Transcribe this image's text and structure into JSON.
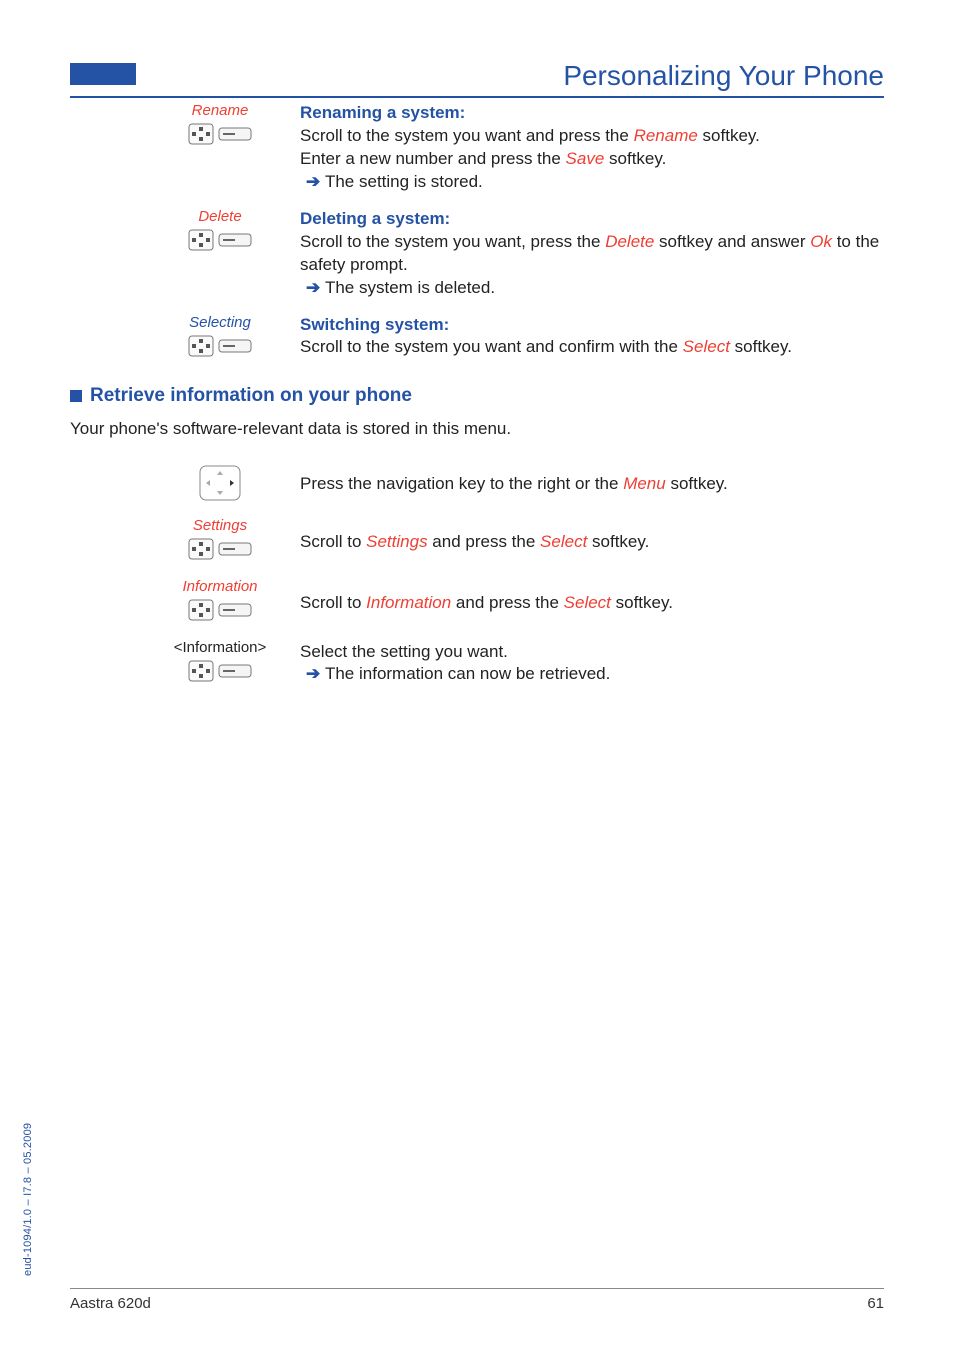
{
  "header": {
    "title": "Personalizing Your Phone"
  },
  "block1": {
    "entries": [
      {
        "lead": {
          "text": "Rename",
          "cls": "red"
        },
        "heading": "Renaming a system:",
        "lines": [
          {
            "plain": "Scroll to the system you want and press the ",
            "soft": "Rename",
            "tail": " softkey."
          },
          {
            "plain": "Enter a new number and press the ",
            "soft": "Save",
            "tail": " softkey."
          }
        ],
        "result": "The setting is stored."
      },
      {
        "lead": {
          "text": "Delete",
          "cls": "red"
        },
        "heading": "Deleting a system:",
        "lines": [
          {
            "plain": "Scroll to the system you want, press the ",
            "soft": "Delete",
            "tail": " softkey and answer ",
            "soft2": "Ok",
            "tail2": " to the safety prompt."
          }
        ],
        "result": "The system is deleted."
      },
      {
        "lead": {
          "text": "Selecting",
          "cls": "blue"
        },
        "heading": "Switching system:",
        "lines": [
          {
            "plain": "Scroll to the system you want and confirm with the ",
            "soft": "Select",
            "tail": " softkey."
          }
        ]
      }
    ]
  },
  "sub": {
    "title": "Retrieve information on your phone"
  },
  "intro": "Your phone's software-relevant data is stored in this menu.",
  "block2": {
    "entries": [
      {
        "lead": {
          "nav": true
        },
        "lines": [
          {
            "plain": "Press the navigation key to the right or the ",
            "soft": "Menu",
            "tail": " softkey."
          }
        ]
      },
      {
        "lead": {
          "text": "Settings",
          "cls": "red"
        },
        "lines": [
          {
            "plain": "Scroll to ",
            "soft": "Settings",
            "tail": " and press the ",
            "soft2": "Select",
            "tail2": " softkey."
          }
        ]
      },
      {
        "lead": {
          "text": "Information",
          "cls": "red"
        },
        "lines": [
          {
            "plain": "Scroll to ",
            "soft": "Information",
            "tail": " and press the ",
            "soft2": "Select",
            "tail2": " softkey."
          }
        ]
      },
      {
        "lead": {
          "text": "<Information>",
          "cls": "black"
        },
        "lines": [
          {
            "plain": "Select the setting you want."
          }
        ],
        "result": "The information can now be retrieved."
      }
    ]
  },
  "side": "eud-1094/1.0 – I7.8 – 05.2009",
  "footer": {
    "left": "Aastra 620d",
    "right": "61"
  }
}
